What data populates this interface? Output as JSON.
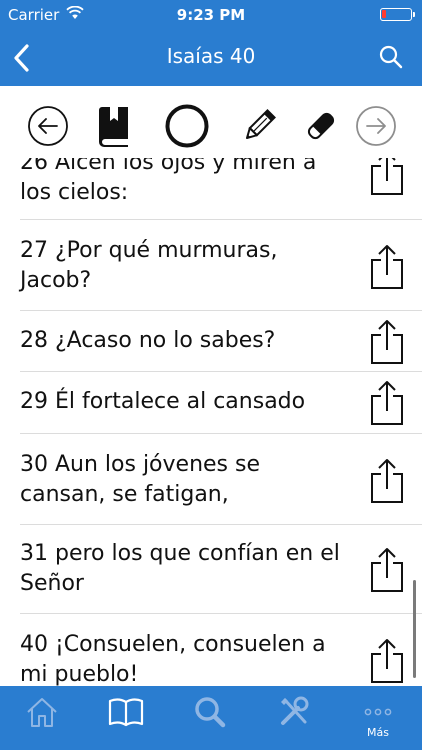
{
  "status_bar": {
    "carrier": "Carrier",
    "time": "9:23 PM"
  },
  "nav": {
    "title": "Isaías 40",
    "back_icon": "chevron-left-icon",
    "search_icon": "search-icon"
  },
  "tools": [
    {
      "name": "previous-chapter-button",
      "icon": "arrow-left-circle-icon"
    },
    {
      "name": "book-button",
      "icon": "book-bookmark-icon"
    },
    {
      "name": "circle-button",
      "icon": "circle-icon"
    },
    {
      "name": "pencil-button",
      "icon": "pencil-icon"
    },
    {
      "name": "eraser-button",
      "icon": "eraser-icon"
    },
    {
      "name": "next-chapter-button",
      "icon": "arrow-right-circle-icon"
    }
  ],
  "verses": [
    {
      "line1": "26 Alcen los ojos y miren a",
      "line2": "los cielos:"
    },
    {
      "line1": "27 ¿Por qué murmuras,",
      "line2": "Jacob?"
    },
    {
      "line1": "28 ¿Acaso no lo sabes?",
      "line2": ""
    },
    {
      "line1": "29 Él fortalece al cansado",
      "line2": ""
    },
    {
      "line1": "30 Aun los jóvenes se",
      "line2": "cansan, se fatigan,"
    },
    {
      "line1": "31 pero los que confían en el",
      "line2": "Señor"
    },
    {
      "line1": "40 ¡Consuelen, consuelen a",
      "line2": "mi pueblo!"
    }
  ],
  "tabs": [
    {
      "icon": "home-icon",
      "label": ""
    },
    {
      "icon": "open-book-icon",
      "label": ""
    },
    {
      "icon": "search-icon",
      "label": ""
    },
    {
      "icon": "tools-icon",
      "label": ""
    },
    {
      "icon": "more-icon",
      "label": "Más"
    }
  ],
  "colors": {
    "bar_blue": "#2a7dd0",
    "tab_inactive": "#8fb6e4",
    "tab_active": "#ffffff"
  }
}
